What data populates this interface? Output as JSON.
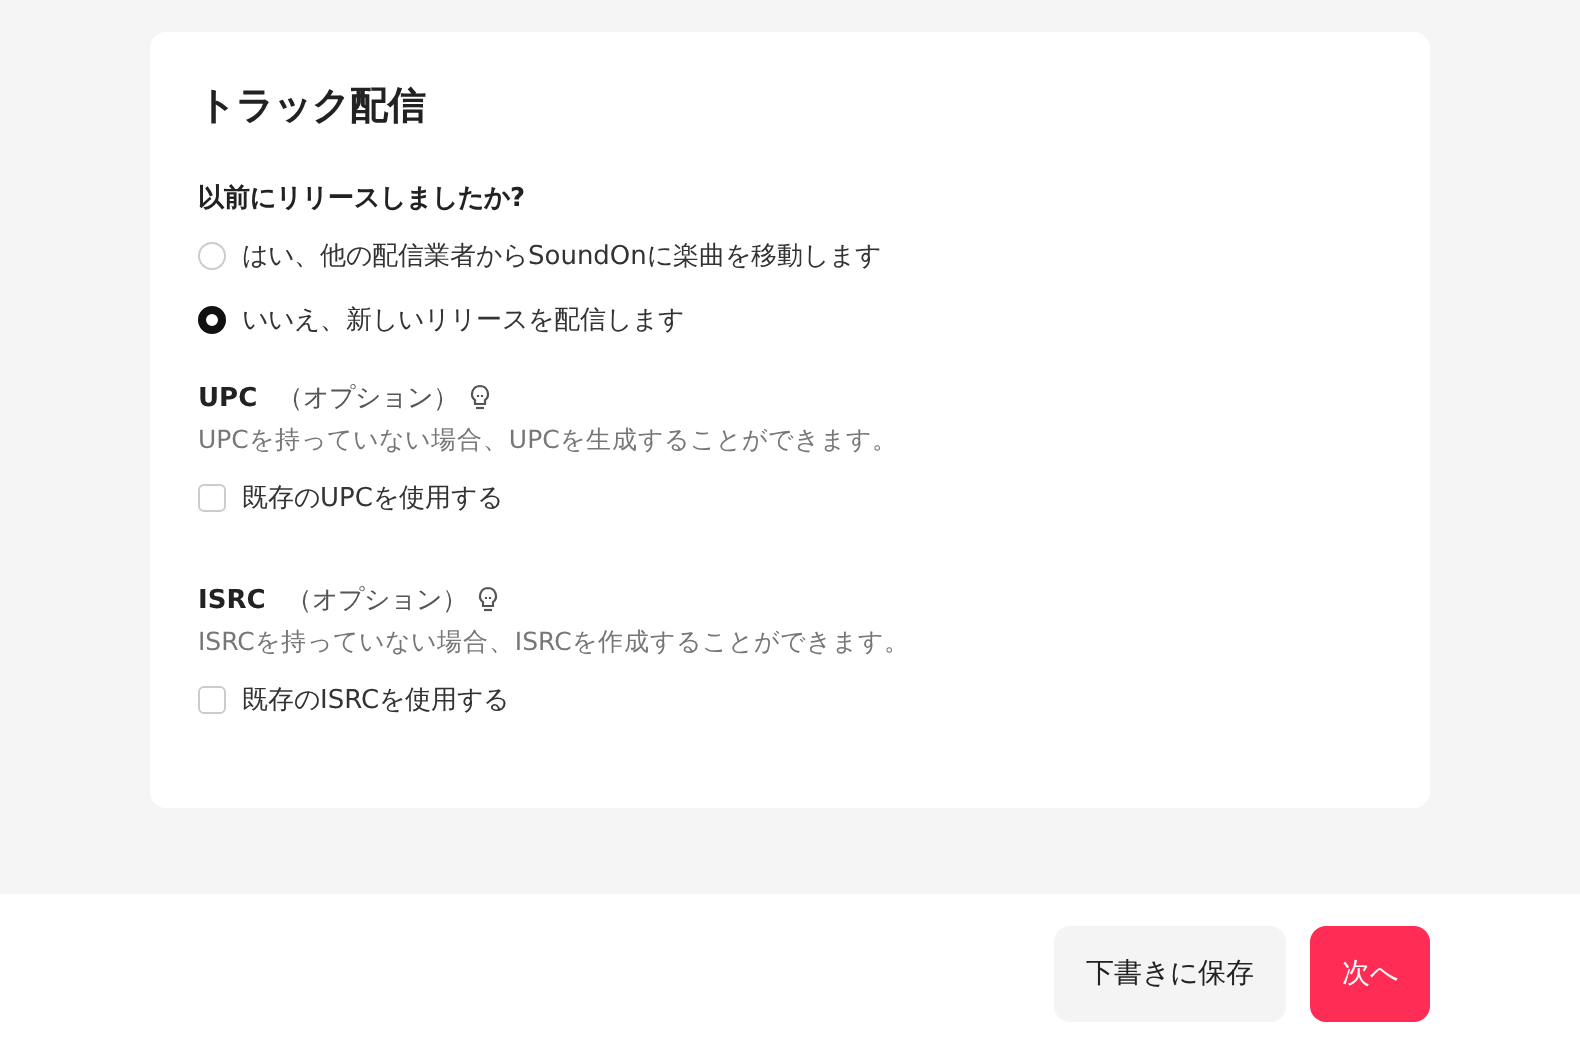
{
  "card": {
    "title": "トラック配信",
    "question": {
      "label": "以前にリリースしましたか?",
      "options": [
        {
          "label": "はい、他の配信業者からSoundOnに楽曲を移動します",
          "selected": false
        },
        {
          "label": "いいえ、新しいリリースを配信します",
          "selected": true
        }
      ]
    },
    "sections": [
      {
        "label": "UPC",
        "optional": "（オプション）",
        "description": "UPCを持っていない場合、UPCを生成することができます。",
        "checkbox": {
          "label": "既存のUPCを使用する",
          "checked": false
        }
      },
      {
        "label": "ISRC",
        "optional": "（オプション）",
        "description": "ISRCを持っていない場合、ISRCを作成することができます。",
        "checkbox": {
          "label": "既存のISRCを使用する",
          "checked": false
        }
      }
    ]
  },
  "footer": {
    "buttons": [
      {
        "label": "下書きに保存",
        "kind": "secondary"
      },
      {
        "label": "次へ",
        "kind": "primary"
      }
    ]
  }
}
